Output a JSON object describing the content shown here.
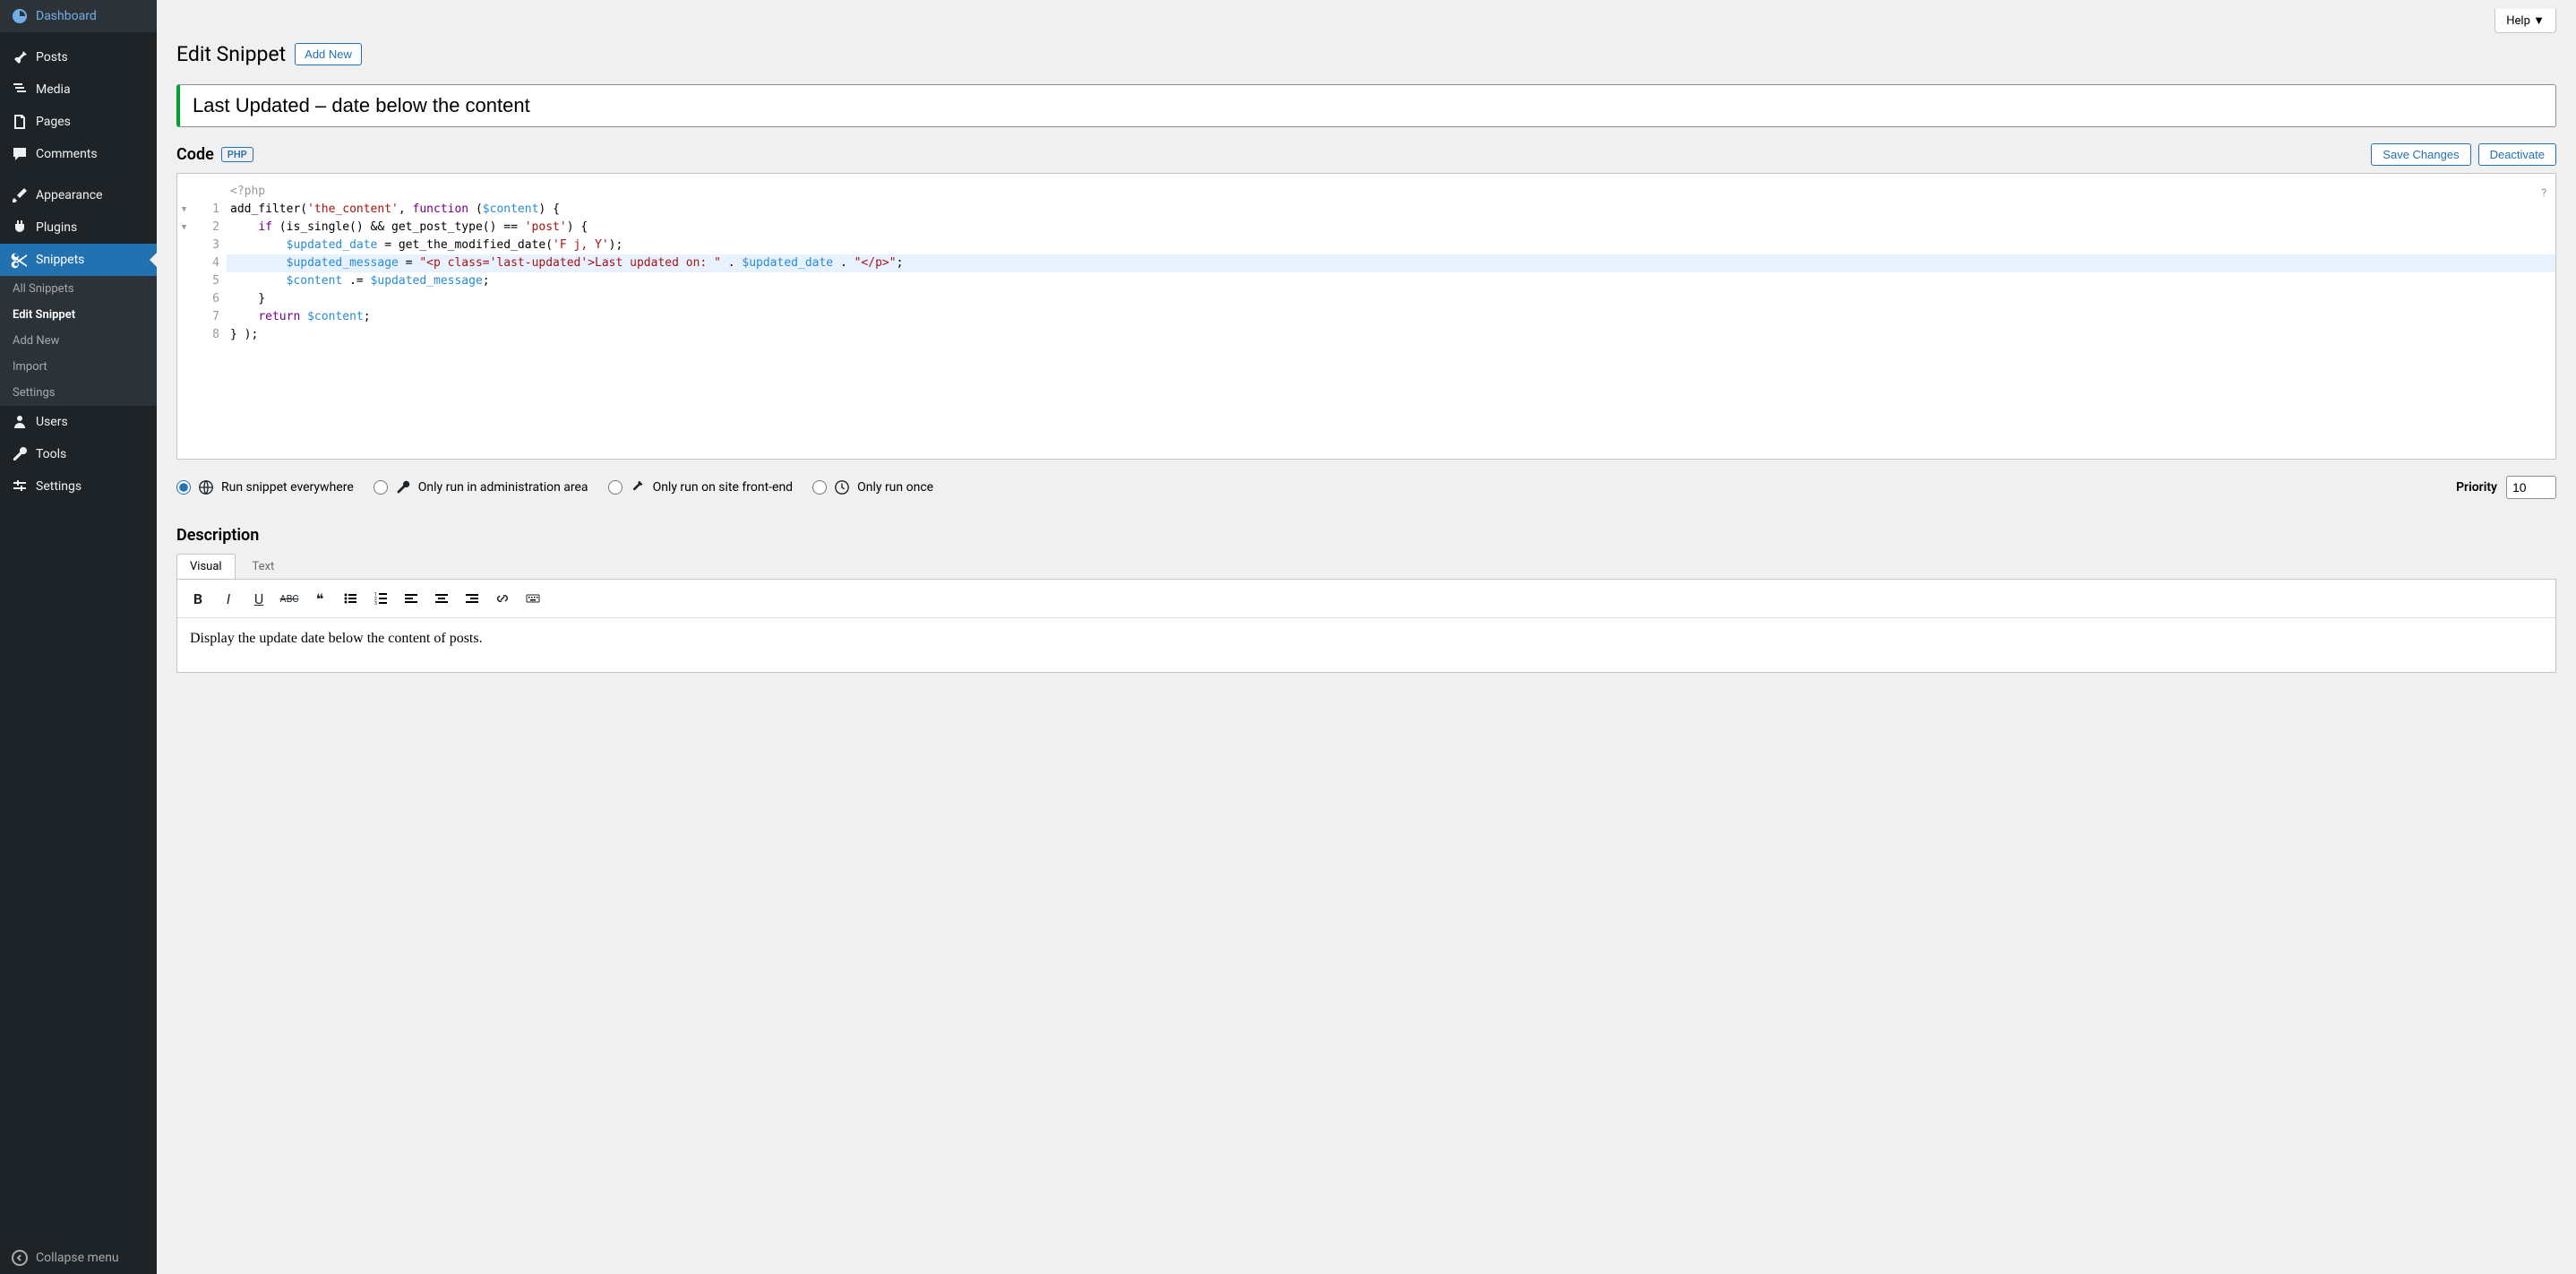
{
  "sidebar": {
    "items": [
      {
        "label": "Dashboard"
      },
      {
        "label": "Posts"
      },
      {
        "label": "Media"
      },
      {
        "label": "Pages"
      },
      {
        "label": "Comments"
      },
      {
        "label": "Appearance"
      },
      {
        "label": "Plugins"
      },
      {
        "label": "Snippets"
      },
      {
        "label": "Users"
      },
      {
        "label": "Tools"
      },
      {
        "label": "Settings"
      }
    ],
    "sub": [
      {
        "label": "All Snippets"
      },
      {
        "label": "Edit Snippet"
      },
      {
        "label": "Add New"
      },
      {
        "label": "Import"
      },
      {
        "label": "Settings"
      }
    ],
    "collapse": "Collapse menu"
  },
  "header": {
    "help": "Help",
    "page_title": "Edit Snippet",
    "add_new": "Add New",
    "title_value": "Last Updated – date below the content"
  },
  "code_section": {
    "label": "Code",
    "badge": "PHP",
    "save": "Save Changes",
    "deactivate": "Deactivate",
    "php_open": "<?php",
    "lines": [
      {
        "n": "1",
        "tokens": [
          {
            "t": "fn",
            "v": "add_filter"
          },
          {
            "t": "",
            "v": "("
          },
          {
            "t": "str",
            "v": "'the_content'"
          },
          {
            "t": "",
            "v": ", "
          },
          {
            "t": "kw",
            "v": "function"
          },
          {
            "t": "",
            "v": " ("
          },
          {
            "t": "var",
            "v": "$content"
          },
          {
            "t": "",
            "v": ") {"
          }
        ]
      },
      {
        "n": "2",
        "tokens": [
          {
            "t": "",
            "v": "    "
          },
          {
            "t": "kw",
            "v": "if"
          },
          {
            "t": "",
            "v": " (is_single() && get_post_type() == "
          },
          {
            "t": "str",
            "v": "'post'"
          },
          {
            "t": "",
            "v": ") {"
          }
        ]
      },
      {
        "n": "3",
        "tokens": [
          {
            "t": "",
            "v": "        "
          },
          {
            "t": "var",
            "v": "$updated_date"
          },
          {
            "t": "",
            "v": " = get_the_modified_date("
          },
          {
            "t": "str",
            "v": "'F j, Y'"
          },
          {
            "t": "",
            "v": ");"
          }
        ]
      },
      {
        "n": "4",
        "hl": true,
        "tokens": [
          {
            "t": "",
            "v": "        "
          },
          {
            "t": "var",
            "v": "$updated_message"
          },
          {
            "t": "",
            "v": " = "
          },
          {
            "t": "str",
            "v": "\"<p class='last-updated'>Last updated on: \""
          },
          {
            "t": "",
            "v": " . "
          },
          {
            "t": "var",
            "v": "$updated_date"
          },
          {
            "t": "",
            "v": " . "
          },
          {
            "t": "str",
            "v": "\"</p>\""
          },
          {
            "t": "",
            "v": ";"
          }
        ]
      },
      {
        "n": "5",
        "tokens": [
          {
            "t": "",
            "v": "        "
          },
          {
            "t": "var",
            "v": "$content"
          },
          {
            "t": "",
            "v": " .= "
          },
          {
            "t": "var",
            "v": "$updated_message"
          },
          {
            "t": "",
            "v": ";"
          }
        ]
      },
      {
        "n": "6",
        "tokens": [
          {
            "t": "",
            "v": "    }"
          }
        ]
      },
      {
        "n": "7",
        "tokens": [
          {
            "t": "",
            "v": "    "
          },
          {
            "t": "kw",
            "v": "return"
          },
          {
            "t": "",
            "v": " "
          },
          {
            "t": "var",
            "v": "$content"
          },
          {
            "t": "",
            "v": ";"
          }
        ]
      },
      {
        "n": "8",
        "tokens": [
          {
            "t": "",
            "v": "} );"
          }
        ]
      }
    ]
  },
  "scope": {
    "opt1": "Run snippet everywhere",
    "opt2": "Only run in administration area",
    "opt3": "Only run on site front-end",
    "opt4": "Only run once",
    "priority_label": "Priority",
    "priority_value": "10"
  },
  "description": {
    "label": "Description",
    "tab_visual": "Visual",
    "tab_text": "Text",
    "content": "Display the update date below the content of posts."
  }
}
